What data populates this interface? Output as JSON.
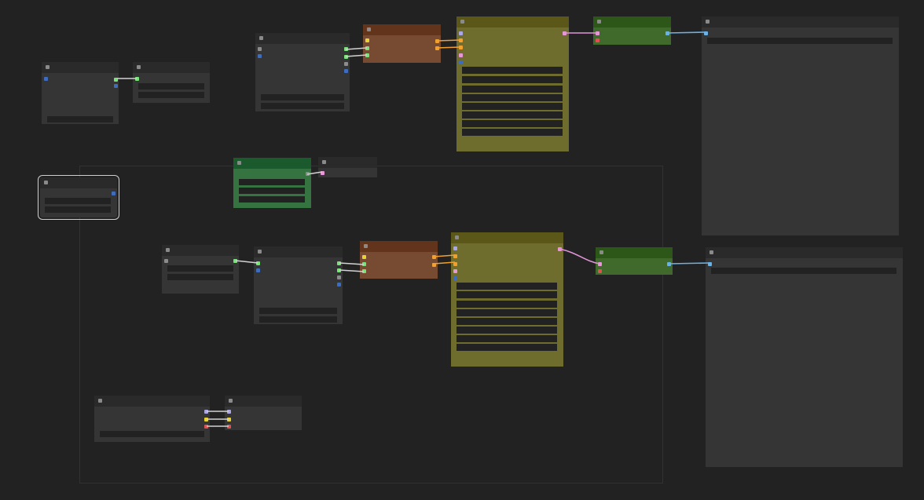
{
  "colors": {
    "canvas": "#222222",
    "node_body": "#353535",
    "node_title": "#2a2a2a",
    "widget": "#222222",
    "brown_title": "#63341c",
    "brown_body": "#774b32",
    "olive_title": "#5a5719",
    "olive_body": "#6f6d2e",
    "green_title": "#2c5719",
    "green_body": "#40692c",
    "teal_title": "#1b5a2c",
    "teal_body": "#357340",
    "group_border": "#2f2f48",
    "link_white": "#d2d2d2",
    "link_orange": "#f0a030",
    "link_pink": "#e094d8",
    "link_blue": "#6ab2e6",
    "slot_green": "#77e477",
    "slot_blue": "#3f6dbd",
    "slot_orange": "#f0a030",
    "slot_yellow": "#e8d330",
    "slot_pink": "#e896d8",
    "slot_red": "#e05050",
    "slot_gray": "#8c8c8c",
    "slot_lavender": "#a9a7e6"
  },
  "nodes": [
    "load-checkpoint-node-1",
    "clip-node-1",
    "prompt-node-1",
    "sampler-node-1",
    "decode-node-1",
    "preview-node-1",
    "note-node",
    "lora-node",
    "load-checkpoint-node-2",
    "prompt-node-2",
    "sampler-node-2",
    "decode-node-2",
    "preview-node-2",
    "selected-node",
    "group-node-a",
    "group-node-b"
  ]
}
